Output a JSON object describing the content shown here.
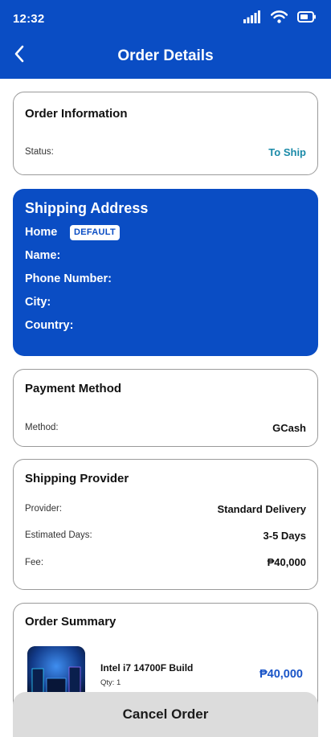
{
  "status_bar": {
    "time": "12:32"
  },
  "header": {
    "title": "Order Details",
    "back_icon": "chevron-left-icon"
  },
  "order_info": {
    "title": "Order Information",
    "status_label": "Status:",
    "status_value": "To Ship",
    "status_color": "#1a8aa8"
  },
  "shipping_address": {
    "title": "Shipping Address",
    "address_type": "Home",
    "badge": "DEFAULT",
    "name_label": "Name:",
    "phone_label": "Phone Number:",
    "city_label": "City:",
    "country_label": "Country:"
  },
  "payment": {
    "title": "Payment Method",
    "method_label": "Method:",
    "method_value": "GCash"
  },
  "shipping_provider": {
    "title": "Shipping Provider",
    "provider_label": "Provider:",
    "provider_value": "Standard Delivery",
    "days_label": "Estimated Days:",
    "days_value": "3-5 Days",
    "fee_label": "Fee:",
    "fee_value": "₱40,000"
  },
  "order_summary": {
    "title": "Order Summary",
    "items": [
      {
        "name": "Intel i7 14700F Build",
        "qty": "Qty: 1",
        "price": "₱40,000"
      }
    ]
  },
  "actions": {
    "cancel_label": "Cancel Order"
  },
  "colors": {
    "primary": "#0a4dc4",
    "price": "#1a55c8",
    "cancel_bg": "#dcdcdc"
  }
}
